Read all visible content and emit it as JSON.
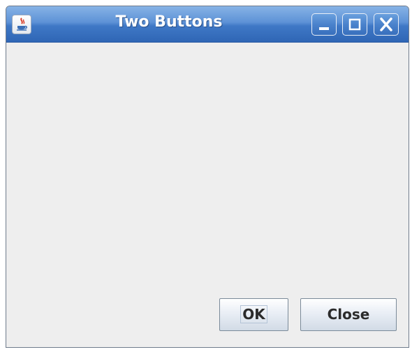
{
  "window": {
    "title": "Two Buttons",
    "icon": "java-app-icon"
  },
  "title_controls": {
    "minimize_icon": "minimize-icon",
    "maximize_icon": "maximize-icon",
    "close_icon": "close-icon"
  },
  "buttons": {
    "ok_label": "OK",
    "close_label": "Close"
  },
  "colors": {
    "titlebar": "#4a82cc",
    "content_background": "#eeeeee",
    "title_text": "#ffffff"
  }
}
